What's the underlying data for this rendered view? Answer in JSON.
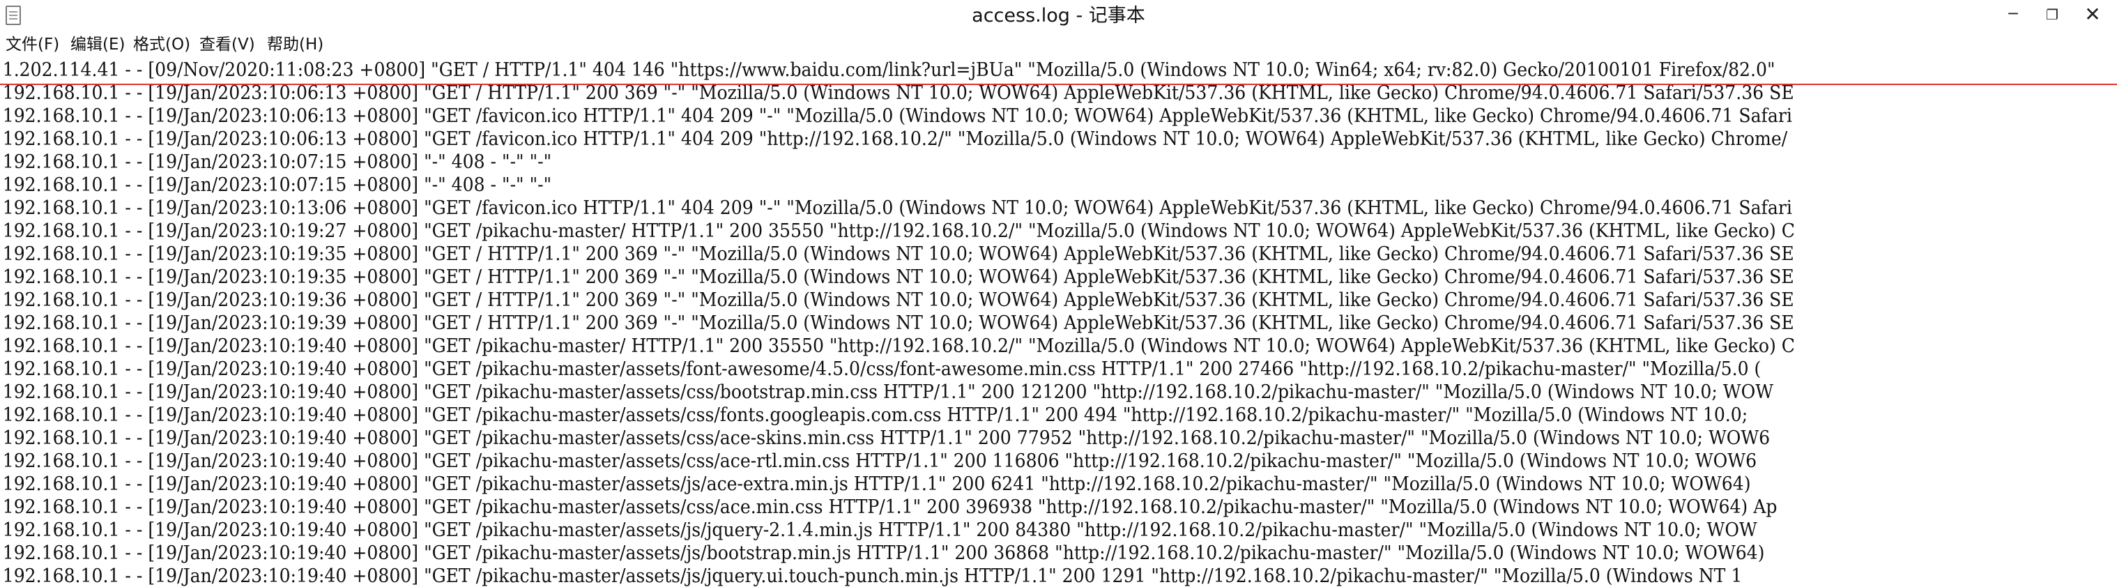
{
  "window": {
    "title": "access.log - 记事本",
    "controls": {
      "minimize": "─",
      "maximize": "❐",
      "close": "✕"
    },
    "icons": {
      "app": "notepad-icon"
    }
  },
  "menu": {
    "items": [
      "文件(F)",
      "编辑(E)",
      "格式(O)",
      "查看(V)",
      "帮助(H)"
    ]
  },
  "highlight": {
    "color": "#e03030",
    "line_index": 0
  },
  "log_lines": [
    "1.202.114.41 - - [09/Nov/2020:11:08:23 +0800] \"GET / HTTP/1.1\" 404 146 \"https://www.baidu.com/link?url=jBUa\" \"Mozilla/5.0 (Windows NT 10.0; Win64; x64; rv:82.0) Gecko/20100101 Firefox/82.0\"",
    "192.168.10.1 - - [19/Jan/2023:10:06:13 +0800] \"GET / HTTP/1.1\" 200 369 \"-\" \"Mozilla/5.0 (Windows NT 10.0; WOW64) AppleWebKit/537.36 (KHTML, like Gecko) Chrome/94.0.4606.71 Safari/537.36 SE",
    "192.168.10.1 - - [19/Jan/2023:10:06:13 +0800] \"GET /favicon.ico HTTP/1.1\" 404 209 \"-\" \"Mozilla/5.0 (Windows NT 10.0; WOW64) AppleWebKit/537.36 (KHTML, like Gecko) Chrome/94.0.4606.71 Safari",
    "192.168.10.1 - - [19/Jan/2023:10:06:13 +0800] \"GET /favicon.ico HTTP/1.1\" 404 209 \"http://192.168.10.2/\" \"Mozilla/5.0 (Windows NT 10.0; WOW64) AppleWebKit/537.36 (KHTML, like Gecko) Chrome/",
    "192.168.10.1 - - [19/Jan/2023:10:07:15 +0800] \"-\" 408 - \"-\" \"-\"",
    "192.168.10.1 - - [19/Jan/2023:10:07:15 +0800] \"-\" 408 - \"-\" \"-\"",
    "192.168.10.1 - - [19/Jan/2023:10:13:06 +0800] \"GET /favicon.ico HTTP/1.1\" 404 209 \"-\" \"Mozilla/5.0 (Windows NT 10.0; WOW64) AppleWebKit/537.36 (KHTML, like Gecko) Chrome/94.0.4606.71 Safari",
    "192.168.10.1 - - [19/Jan/2023:10:19:27 +0800] \"GET /pikachu-master/ HTTP/1.1\" 200 35550 \"http://192.168.10.2/\" \"Mozilla/5.0 (Windows NT 10.0; WOW64) AppleWebKit/537.36 (KHTML, like Gecko) C",
    "192.168.10.1 - - [19/Jan/2023:10:19:35 +0800] \"GET / HTTP/1.1\" 200 369 \"-\" \"Mozilla/5.0 (Windows NT 10.0; WOW64) AppleWebKit/537.36 (KHTML, like Gecko) Chrome/94.0.4606.71 Safari/537.36 SE",
    "192.168.10.1 - - [19/Jan/2023:10:19:35 +0800] \"GET / HTTP/1.1\" 200 369 \"-\" \"Mozilla/5.0 (Windows NT 10.0; WOW64) AppleWebKit/537.36 (KHTML, like Gecko) Chrome/94.0.4606.71 Safari/537.36 SE",
    "192.168.10.1 - - [19/Jan/2023:10:19:36 +0800] \"GET / HTTP/1.1\" 200 369 \"-\" \"Mozilla/5.0 (Windows NT 10.0; WOW64) AppleWebKit/537.36 (KHTML, like Gecko) Chrome/94.0.4606.71 Safari/537.36 SE",
    "192.168.10.1 - - [19/Jan/2023:10:19:39 +0800] \"GET / HTTP/1.1\" 200 369 \"-\" \"Mozilla/5.0 (Windows NT 10.0; WOW64) AppleWebKit/537.36 (KHTML, like Gecko) Chrome/94.0.4606.71 Safari/537.36 SE",
    "192.168.10.1 - - [19/Jan/2023:10:19:40 +0800] \"GET /pikachu-master/ HTTP/1.1\" 200 35550 \"http://192.168.10.2/\" \"Mozilla/5.0 (Windows NT 10.0; WOW64) AppleWebKit/537.36 (KHTML, like Gecko) C",
    "192.168.10.1 - - [19/Jan/2023:10:19:40 +0800] \"GET /pikachu-master/assets/font-awesome/4.5.0/css/font-awesome.min.css HTTP/1.1\" 200 27466 \"http://192.168.10.2/pikachu-master/\" \"Mozilla/5.0 (",
    "192.168.10.1 - - [19/Jan/2023:10:19:40 +0800] \"GET /pikachu-master/assets/css/bootstrap.min.css HTTP/1.1\" 200 121200 \"http://192.168.10.2/pikachu-master/\" \"Mozilla/5.0 (Windows NT 10.0; WOW",
    "192.168.10.1 - - [19/Jan/2023:10:19:40 +0800] \"GET /pikachu-master/assets/css/fonts.googleapis.com.css HTTP/1.1\" 200 494 \"http://192.168.10.2/pikachu-master/\" \"Mozilla/5.0 (Windows NT 10.0;",
    "192.168.10.1 - - [19/Jan/2023:10:19:40 +0800] \"GET /pikachu-master/assets/css/ace-skins.min.css HTTP/1.1\" 200 77952 \"http://192.168.10.2/pikachu-master/\" \"Mozilla/5.0 (Windows NT 10.0; WOW6",
    "192.168.10.1 - - [19/Jan/2023:10:19:40 +0800] \"GET /pikachu-master/assets/css/ace-rtl.min.css HTTP/1.1\" 200 116806 \"http://192.168.10.2/pikachu-master/\" \"Mozilla/5.0 (Windows NT 10.0; WOW6",
    "192.168.10.1 - - [19/Jan/2023:10:19:40 +0800] \"GET /pikachu-master/assets/js/ace-extra.min.js HTTP/1.1\" 200 6241 \"http://192.168.10.2/pikachu-master/\" \"Mozilla/5.0 (Windows NT 10.0; WOW64)",
    "192.168.10.1 - - [19/Jan/2023:10:19:40 +0800] \"GET /pikachu-master/assets/css/ace.min.css HTTP/1.1\" 200 396938 \"http://192.168.10.2/pikachu-master/\" \"Mozilla/5.0 (Windows NT 10.0; WOW64) Ap",
    "192.168.10.1 - - [19/Jan/2023:10:19:40 +0800] \"GET /pikachu-master/assets/js/jquery-2.1.4.min.js HTTP/1.1\" 200 84380 \"http://192.168.10.2/pikachu-master/\" \"Mozilla/5.0 (Windows NT 10.0; WOW",
    "192.168.10.1 - - [19/Jan/2023:10:19:40 +0800] \"GET /pikachu-master/assets/js/bootstrap.min.js HTTP/1.1\" 200 36868 \"http://192.168.10.2/pikachu-master/\" \"Mozilla/5.0 (Windows NT 10.0; WOW64)",
    "192.168.10.1 - - [19/Jan/2023:10:19:40 +0800] \"GET /pikachu-master/assets/js/jquery.ui.touch-punch.min.js HTTP/1.1\" 200 1291 \"http://192.168.10.2/pikachu-master/\" \"Mozilla/5.0 (Windows NT 1"
  ]
}
